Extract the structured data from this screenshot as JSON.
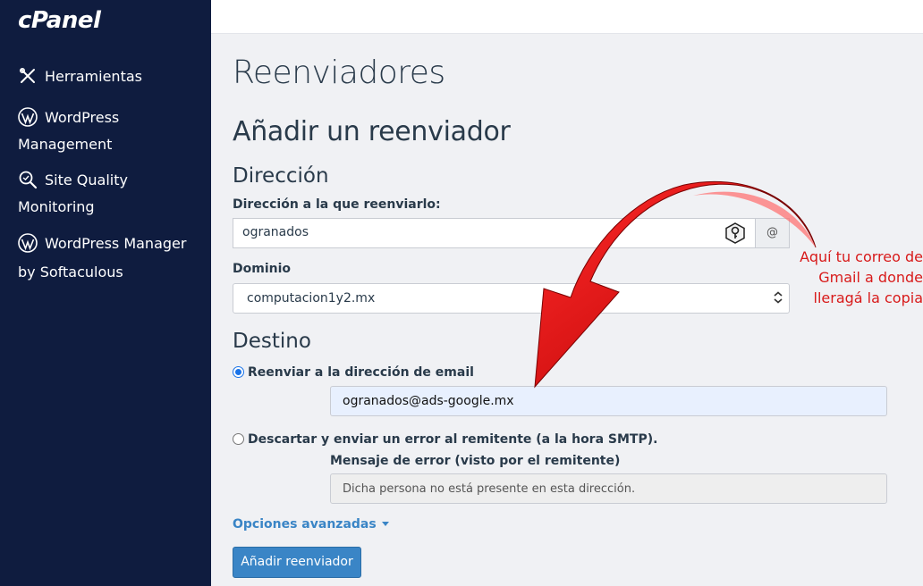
{
  "sidebar": {
    "logo": "cPanel",
    "items": [
      {
        "label": "Herramientas",
        "icon": "tools-icon"
      },
      {
        "label": "WordPress Management",
        "icon": "wordpress-icon"
      },
      {
        "label": "Site Quality Monitoring",
        "icon": "magnifier-icon"
      },
      {
        "label": "WordPress Manager by Softaculous",
        "icon": "wordpress-icon"
      }
    ]
  },
  "main": {
    "page_title": "Reenviadores",
    "section_title": "Añadir un reenviador",
    "address_heading": "Dirección",
    "address_label": "Dirección a la que reenviarlo:",
    "address_value": "ogranados",
    "at_symbol": "@",
    "domain_label": "Dominio",
    "domain_value": "computacion1y2.mx",
    "destination_heading": "Destino",
    "forward_radio_label": "Reenviar a la dirección de email",
    "forward_value": "ogranados@ads-google.mx",
    "discard_radio_label": "Descartar y enviar un error al remitente (a la hora SMTP).",
    "error_label": "Mensaje de error (visto por el remitente)",
    "error_placeholder": "Dicha persona no está presente en esta dirección.",
    "advanced_label": "Opciones avanzadas",
    "submit_label": "Añadir reenviador"
  },
  "annotation": {
    "line1": "Aquí tu correo de",
    "line2": "Gmail a donde",
    "line3": "lleragá la copia",
    "color": "#d81a1a"
  },
  "colors": {
    "sidebar_bg": "#0f1c3f",
    "accent": "#3a85c6"
  }
}
